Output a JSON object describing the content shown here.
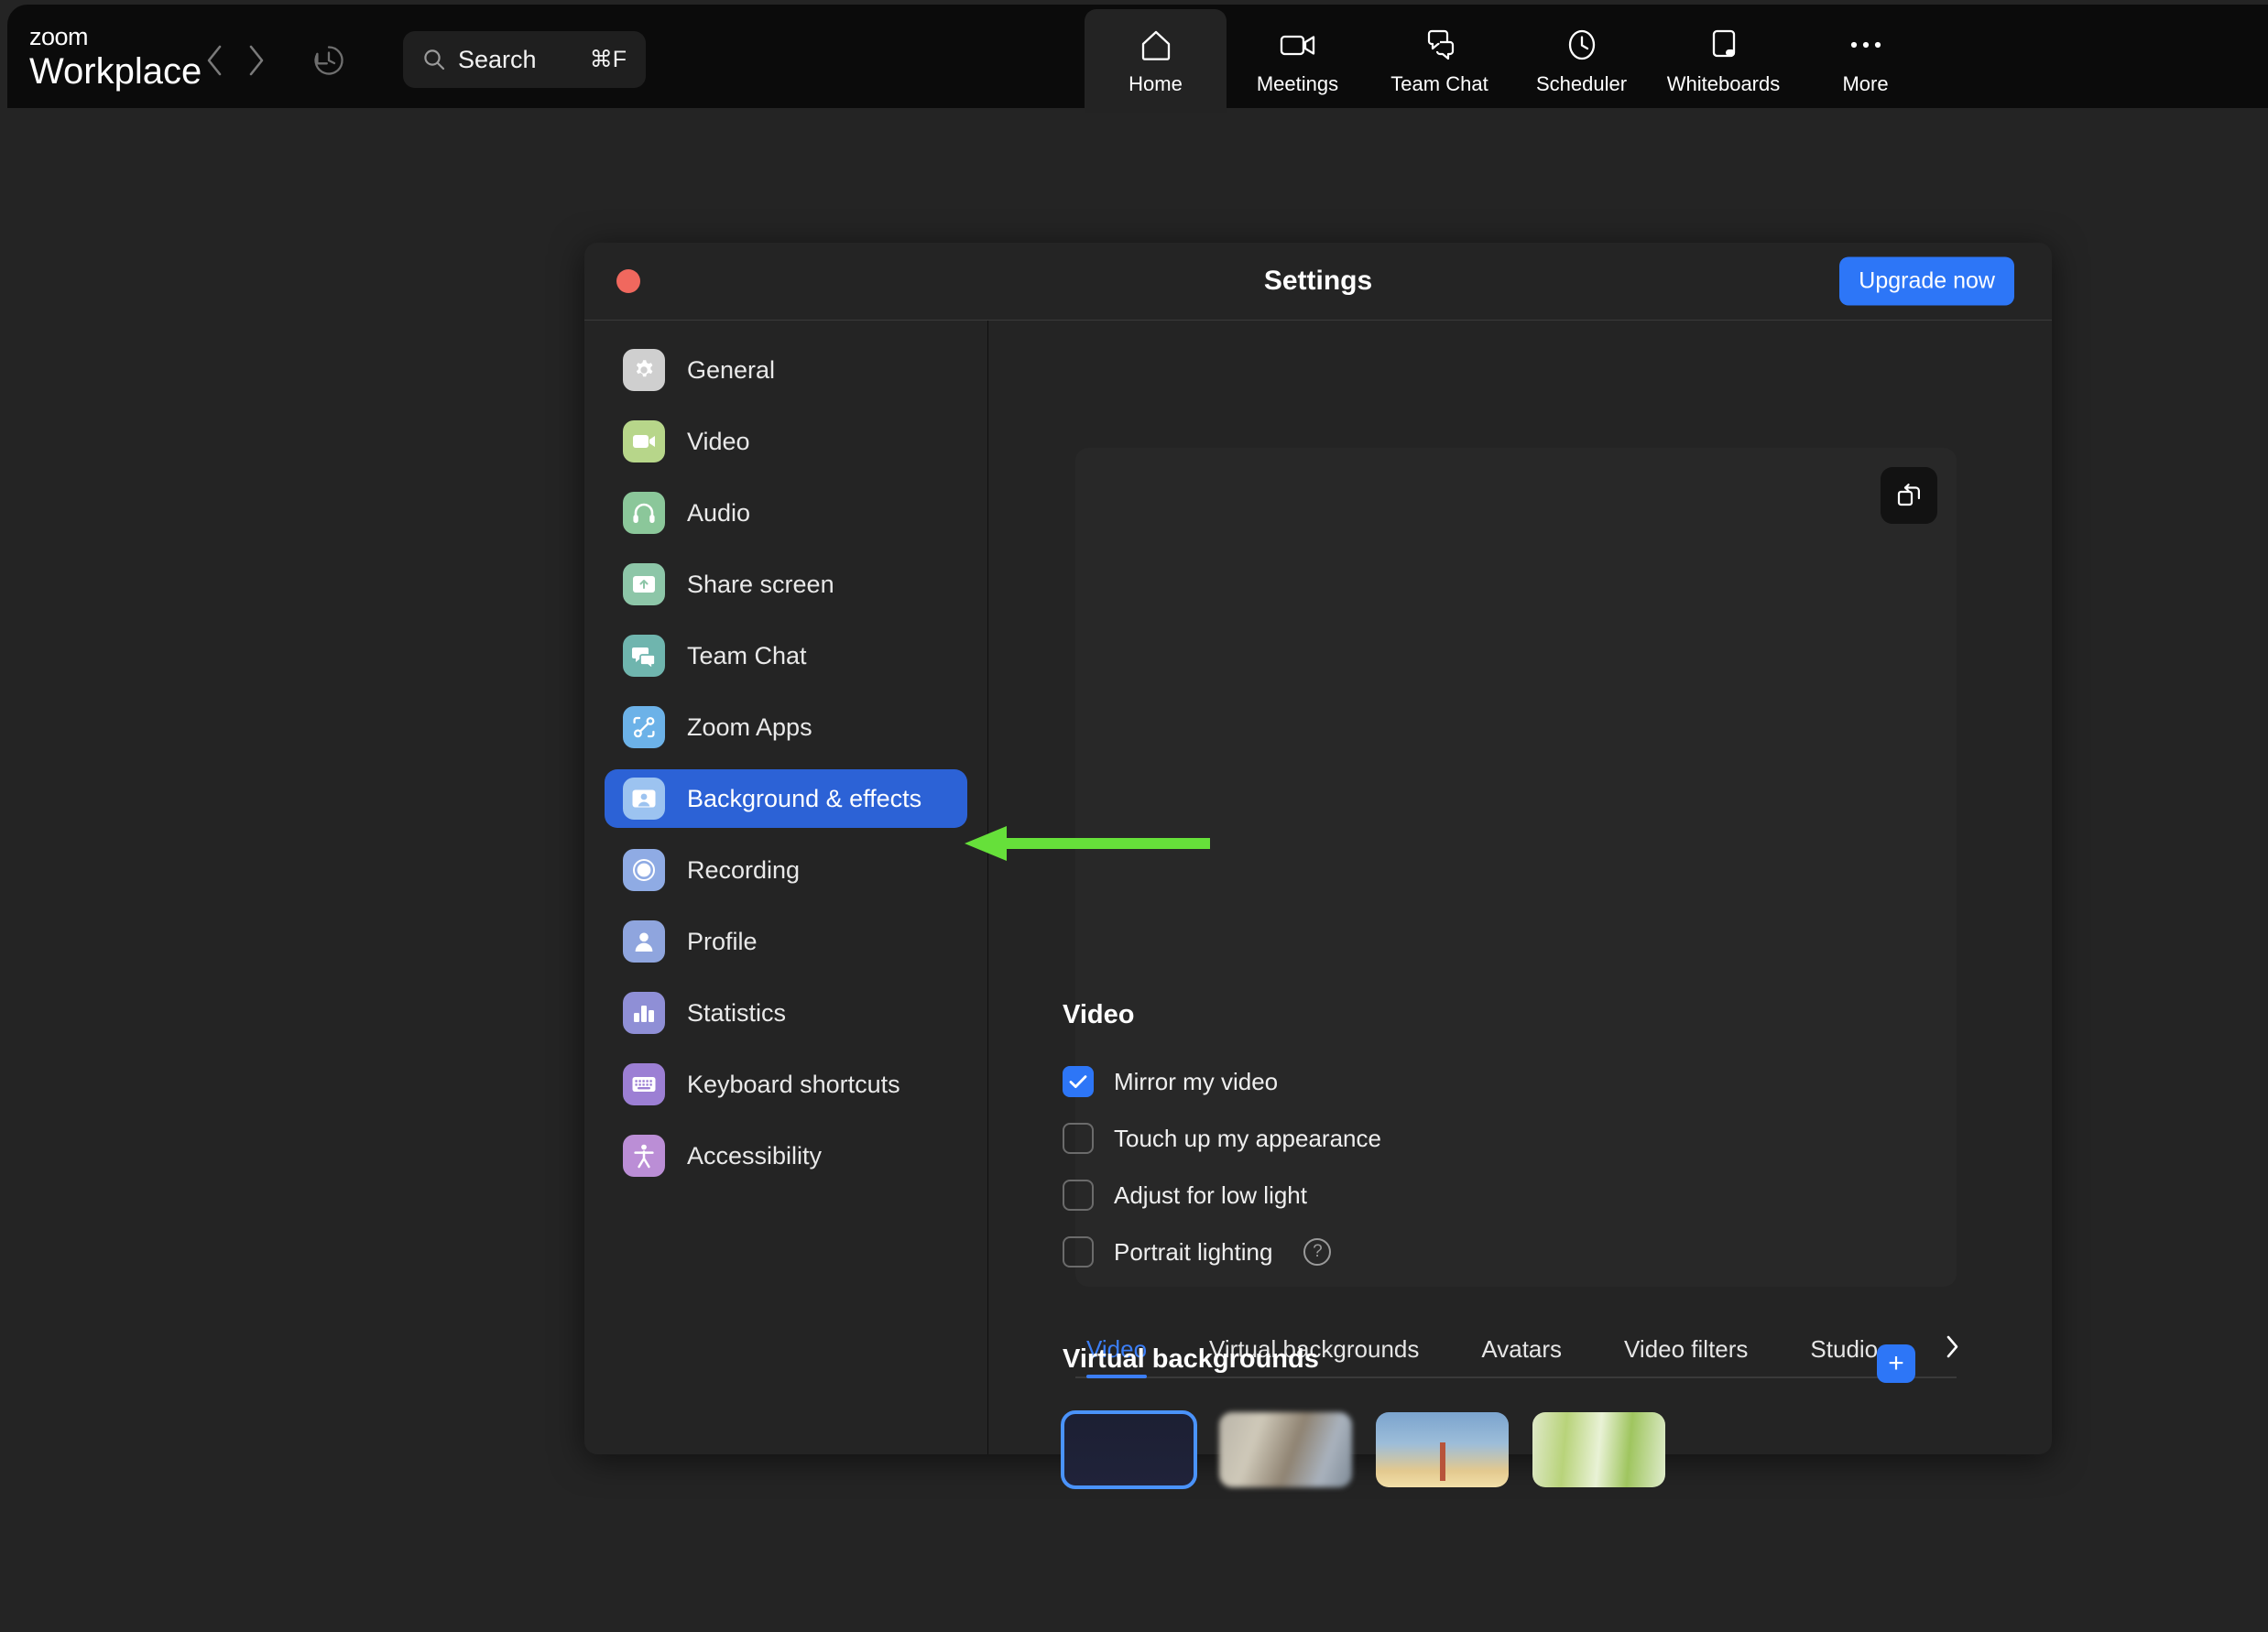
{
  "app": {
    "brand_line1": "zoom",
    "brand_line2": "Workplace",
    "back_icon": "chevron-left-icon",
    "forward_icon": "chevron-right-icon",
    "history_icon": "history-clock-icon"
  },
  "search": {
    "icon": "search-icon",
    "placeholder": "Search",
    "shortcut": "⌘F"
  },
  "nav_tabs": [
    {
      "label": "Home",
      "icon": "home-icon",
      "active": true
    },
    {
      "label": "Meetings",
      "icon": "video-camera-icon",
      "active": false
    },
    {
      "label": "Team Chat",
      "icon": "chat-bubbles-icon",
      "active": false
    },
    {
      "label": "Scheduler",
      "icon": "clock-icon",
      "active": false
    },
    {
      "label": "Whiteboards",
      "icon": "whiteboard-icon",
      "active": false
    },
    {
      "label": "More",
      "icon": "ellipsis-icon",
      "active": false
    }
  ],
  "dialog": {
    "title": "Settings",
    "close_button": "close-window-button",
    "upgrade_label": "Upgrade now",
    "accent_color": "#2d76f7",
    "close_color": "#f0685e"
  },
  "sidebar": {
    "items": [
      {
        "label": "General",
        "icon": "gear-icon",
        "color": "#cfcfcf",
        "active": false
      },
      {
        "label": "Video",
        "icon": "video-icon",
        "color": "#b7d68a",
        "active": false
      },
      {
        "label": "Audio",
        "icon": "headphones-icon",
        "color": "#8bc79a",
        "active": false
      },
      {
        "label": "Share screen",
        "icon": "share-screen-icon",
        "color": "#8dc6a8",
        "active": false
      },
      {
        "label": "Team Chat",
        "icon": "team-chat-icon",
        "color": "#6fb5ae",
        "active": false
      },
      {
        "label": "Zoom Apps",
        "icon": "zoom-apps-icon",
        "color": "#6cb2e8",
        "active": false
      },
      {
        "label": "Background & effects",
        "icon": "background-effects-icon",
        "color": "#9cc3f0",
        "active": true
      },
      {
        "label": "Recording",
        "icon": "record-icon",
        "color": "#8fabe4",
        "active": false
      },
      {
        "label": "Profile",
        "icon": "profile-icon",
        "color": "#8fa5de",
        "active": false
      },
      {
        "label": "Statistics",
        "icon": "bar-chart-icon",
        "color": "#8f8fd6",
        "active": false
      },
      {
        "label": "Keyboard shortcuts",
        "icon": "keyboard-icon",
        "color": "#9c7fd4",
        "active": false
      },
      {
        "label": "Accessibility",
        "icon": "accessibility-icon",
        "color": "#bb8ed6",
        "active": false
      }
    ]
  },
  "preview": {
    "rotate_button_icon": "rotate-camera-icon"
  },
  "content_tabs": [
    {
      "label": "Video",
      "active": true
    },
    {
      "label": "Virtual backgrounds",
      "active": false
    },
    {
      "label": "Avatars",
      "active": false
    },
    {
      "label": "Video filters",
      "active": false
    },
    {
      "label": "Studio",
      "active": false
    }
  ],
  "content_tabs_overflow_icon": "chevron-right-icon",
  "video_section": {
    "title": "Video",
    "options": [
      {
        "label": "Mirror my video",
        "checked": true,
        "help": false
      },
      {
        "label": "Touch up my appearance",
        "checked": false,
        "help": false
      },
      {
        "label": "Adjust for low light",
        "checked": false,
        "help": false
      },
      {
        "label": "Portrait lighting",
        "checked": false,
        "help": true
      }
    ]
  },
  "virtual_backgrounds": {
    "title": "Virtual backgrounds",
    "add_button_icon": "plus-icon",
    "add_button_label": "+",
    "thumbnails": [
      {
        "name": "none-selected-thumbnail",
        "selected": true,
        "style": "dark"
      },
      {
        "name": "blur-thumbnail",
        "selected": false,
        "style": "blur"
      },
      {
        "name": "golden-gate-thumbnail",
        "selected": false,
        "style": "bridge"
      },
      {
        "name": "grass-thumbnail",
        "selected": false,
        "style": "grass"
      }
    ]
  },
  "annotation": {
    "type": "arrow",
    "color": "#66e03a",
    "points_to": "Background & effects"
  }
}
